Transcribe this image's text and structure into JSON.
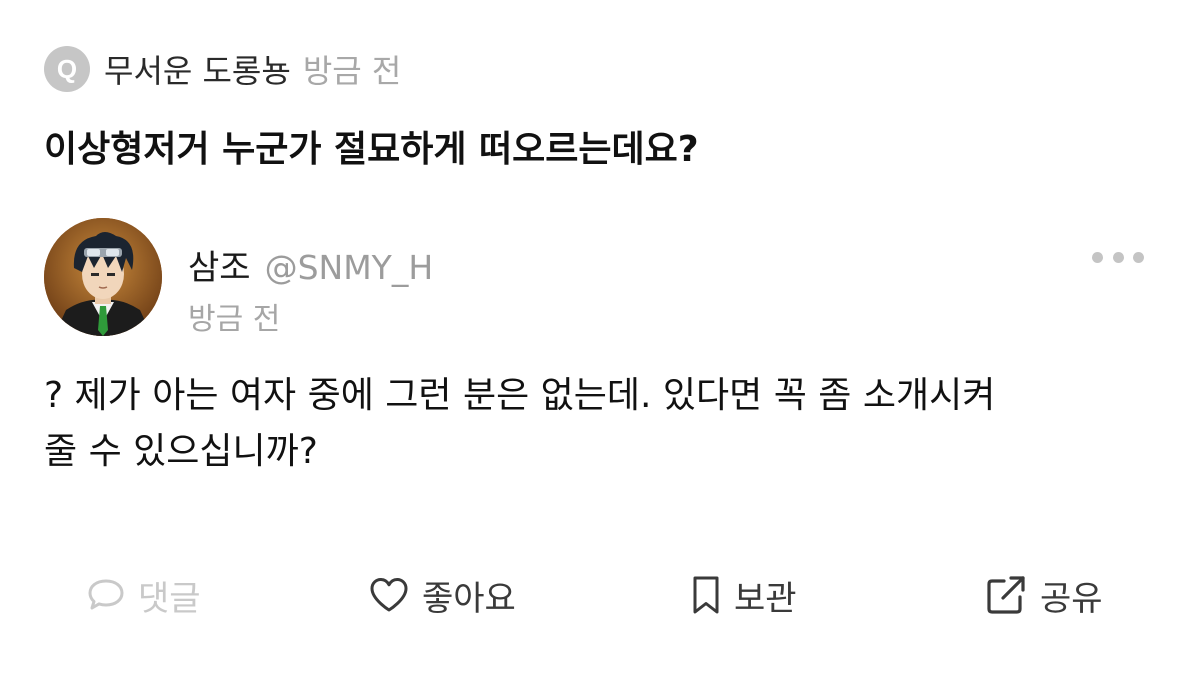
{
  "question": {
    "badge_letter": "Q",
    "author": "무서운 도롱뇽",
    "time": "방금 전",
    "text": "이상형저거 누군가 절묘하게 떠오르는데요?"
  },
  "answer": {
    "author_name": "삼조",
    "author_handle": "@SNMY_H",
    "time": "방금 전",
    "avatar_icon": "anime-character-avatar",
    "body_lines": [
      "? 제가 아는 여자 중에 그런 분은 없는데. 있다면 꼭 좀 소개시켜",
      "줄 수 있으십니까?"
    ]
  },
  "actions": {
    "comment_label": "댓글",
    "like_label": "좋아요",
    "save_label": "보관",
    "share_label": "공유"
  },
  "colors": {
    "disabled": "#c9c9c9",
    "muted": "#a8a8a8",
    "text": "#111111"
  }
}
